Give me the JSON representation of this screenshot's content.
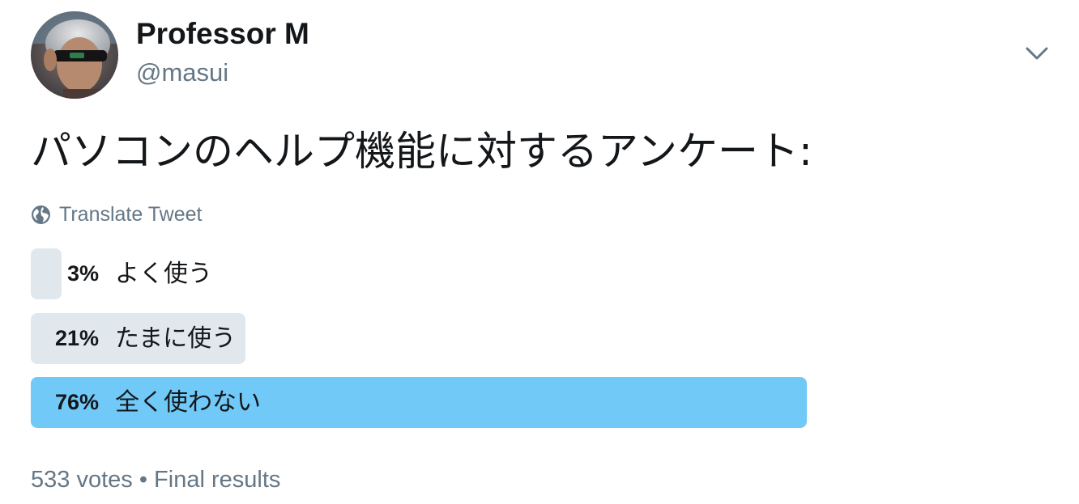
{
  "tweet": {
    "author": {
      "display_name": "Professor M",
      "handle": "@masui",
      "avatar_icon": "profile-photo"
    },
    "menu_icon": "chevron-down-icon",
    "text": "パソコンのヘルプ機能に対するアンケート:",
    "translate_label": "Translate Tweet",
    "translate_icon": "globe-icon"
  },
  "poll": {
    "options": [
      {
        "percent": "3%",
        "label": "よく使う",
        "share": 0.03,
        "winner": false
      },
      {
        "percent": "21%",
        "label": "たまに使う",
        "share": 0.21,
        "winner": false
      },
      {
        "percent": "76%",
        "label": "全く使わない",
        "share": 0.76,
        "winner": true
      }
    ],
    "votes": "533 votes",
    "separator": "•",
    "status": "Final results"
  },
  "colors": {
    "text_primary": "#14171a",
    "text_secondary": "#657786",
    "bar_default": "#e1e8ed",
    "bar_winner": "#71c9f8"
  }
}
